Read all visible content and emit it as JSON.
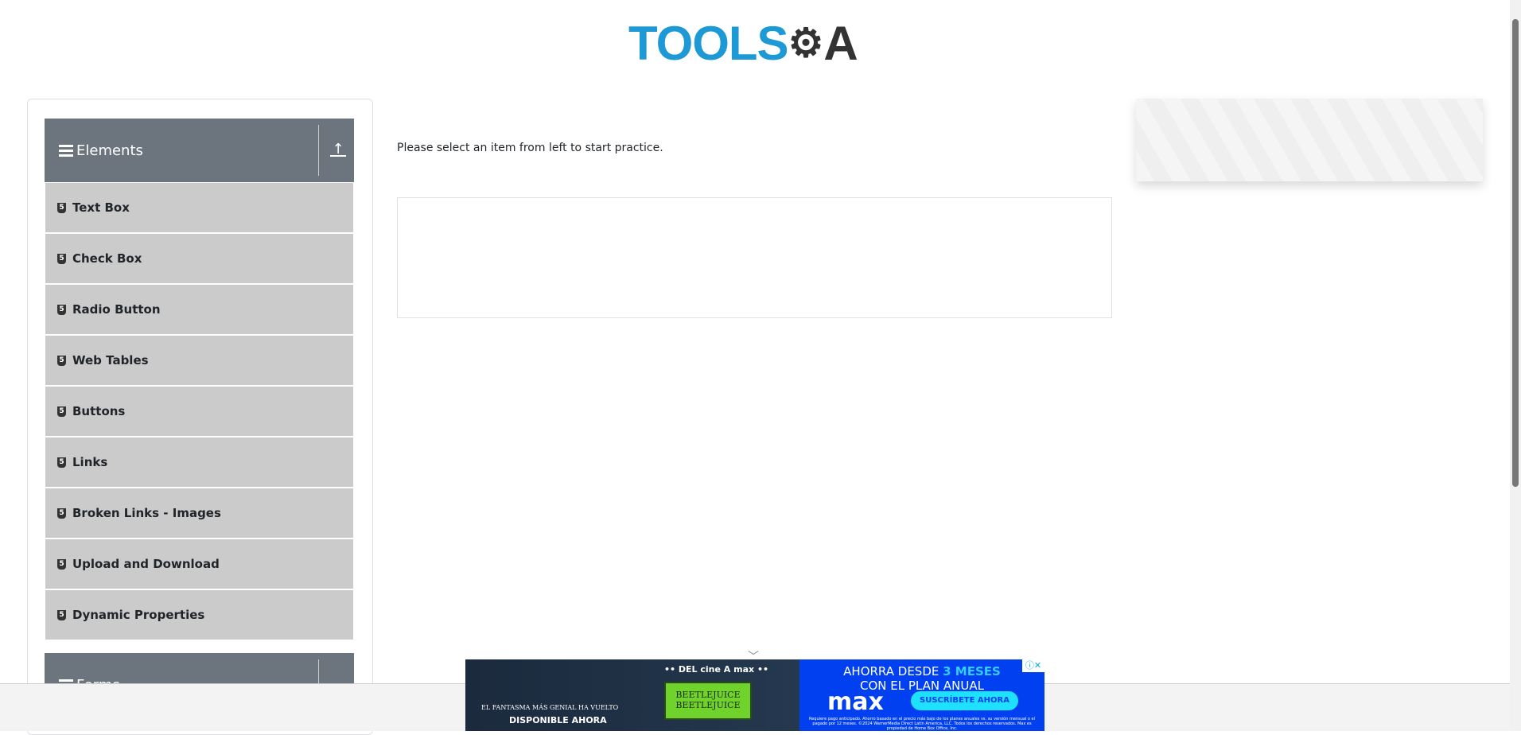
{
  "logo": {
    "part1": "TOOLS",
    "part2": "QA"
  },
  "sidebar": {
    "groups": [
      {
        "label": "Elements"
      },
      {
        "label": "Forms"
      }
    ],
    "items": [
      {
        "label": "Text Box"
      },
      {
        "label": "Check Box"
      },
      {
        "label": "Radio Button"
      },
      {
        "label": "Web Tables"
      },
      {
        "label": "Buttons"
      },
      {
        "label": "Links"
      },
      {
        "label": "Broken Links - Images"
      },
      {
        "label": "Upload and Download"
      },
      {
        "label": "Dynamic Properties"
      }
    ]
  },
  "main": {
    "message": "Please select an item from left to start practice."
  },
  "ad": {
    "left_tag": "•• DEL cine A max ••",
    "movie": "BEETLEJUICE BEETLEJUICE",
    "tagline": "EL FANTASMA MÁS GENIAL HA VUELTO",
    "available": "DISPONIBLE AHORA",
    "headline": "AHORRA DESDE",
    "highlight": "3 MESES",
    "headline2": "CON EL PLAN ANUAL",
    "brand": "max",
    "cta": "SUSCRÍBETE AHORA",
    "fine_print": "Requiere pago anticipado. Ahorro basado en el precio más bajo de los planes anuales vs. su versión mensual o el pagado por 12 meses. ©2024 WarnerMedia Direct Latin America, LLC. Todos los derechos reservados. Max es propiedad de Home Box Office, Inc.",
    "close": "ⓘ✕"
  },
  "colors": {
    "header": "#6c757d",
    "item": "#cbcbcb",
    "brand": "#1d9ad6"
  }
}
